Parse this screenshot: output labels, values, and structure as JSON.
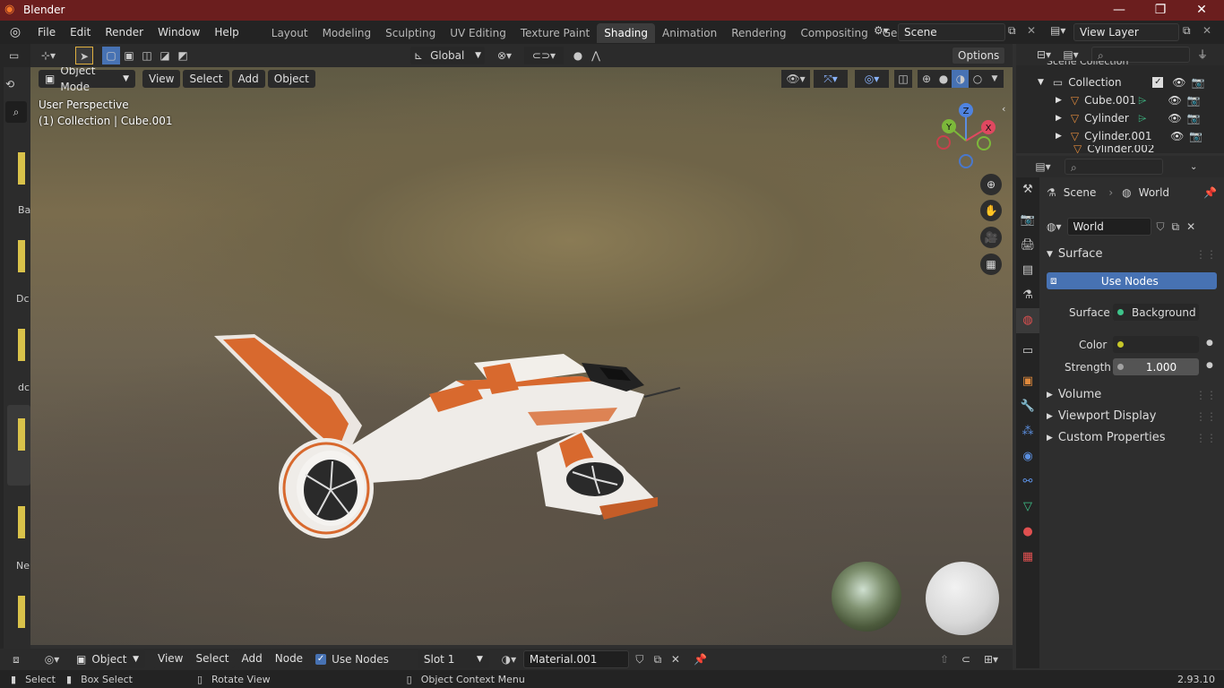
{
  "app": {
    "title": "Blender",
    "version": "2.93.10"
  },
  "window_controls": {
    "minimize": "—",
    "maximize": "❐",
    "close": "✕"
  },
  "menu": [
    "File",
    "Edit",
    "Render",
    "Window",
    "Help"
  ],
  "workspaces": [
    "Layout",
    "Modeling",
    "Sculpting",
    "UV Editing",
    "Texture Paint",
    "Shading",
    "Animation",
    "Rendering",
    "Compositing",
    "Geometry Nod"
  ],
  "active_workspace": "Shading",
  "scene_field": "Scene",
  "view_layer_field": "View Layer",
  "toolbar": {
    "transform": "Global",
    "options": "Options"
  },
  "viewport_header": {
    "mode": "Object Mode",
    "menus": [
      "View",
      "Select",
      "Add",
      "Object"
    ]
  },
  "viewport": {
    "perspective": "User Perspective",
    "context": "(1) Collection | Cube.001",
    "gizmo": {
      "z": "Z",
      "y": "Y",
      "x": "X"
    }
  },
  "left_labels": [
    "Ba",
    "Dc",
    "dc",
    "Ne"
  ],
  "outliner": {
    "partial_top": "Scene Collection",
    "collection": "Collection",
    "items": [
      "Cube.001",
      "Cylinder",
      "Cylinder.001",
      "Cylinder.002"
    ]
  },
  "properties": {
    "breadcrumb_scene": "Scene",
    "breadcrumb_world": "World",
    "world_field": "World",
    "surface_panel": "Surface",
    "use_nodes_button": "Use Nodes",
    "surface_label": "Surface",
    "surface_value": "Background",
    "color_label": "Color",
    "strength_label": "Strength",
    "strength_value": "1.000",
    "panels": [
      "Volume",
      "Viewport Display",
      "Custom Properties"
    ]
  },
  "node_header": {
    "type": "Object",
    "menus": [
      "View",
      "Select",
      "Add",
      "Node"
    ],
    "use_nodes": "Use Nodes",
    "slot": "Slot 1",
    "material": "Material.001"
  },
  "status": {
    "select": "Select",
    "box_select": "Box Select",
    "rotate": "Rotate View",
    "context_menu": "Object Context Menu"
  },
  "colors": {
    "accent": "#4772b3",
    "titlebar": "#6b1e1e",
    "ship_orange": "#d8692e"
  }
}
